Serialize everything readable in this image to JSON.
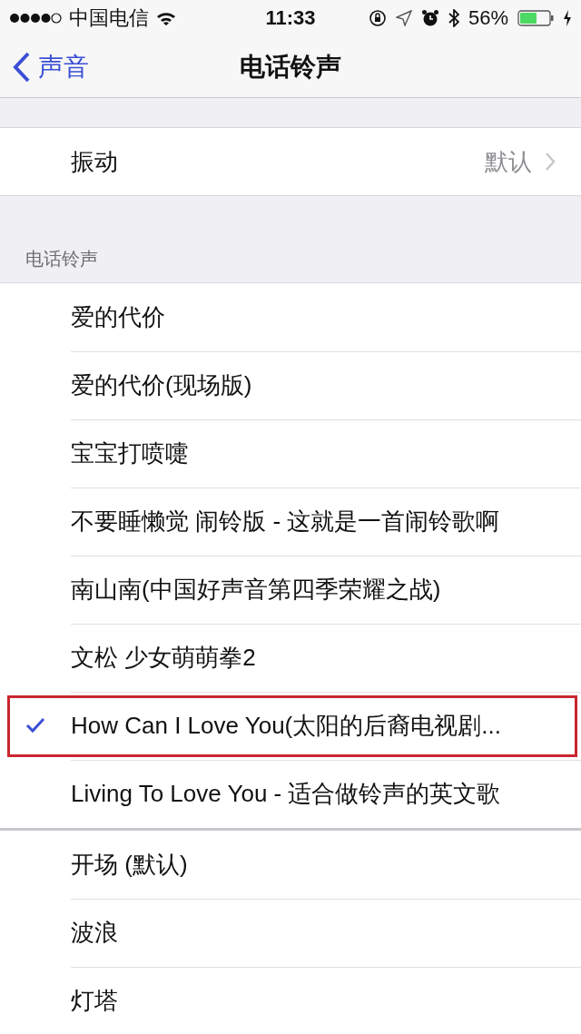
{
  "status_bar": {
    "carrier": "中国电信",
    "time": "11:33",
    "battery_percent": "56%"
  },
  "nav": {
    "back_label": "声音",
    "title": "电话铃声"
  },
  "vibration": {
    "label": "振动",
    "value": "默认"
  },
  "section_header": "电话铃声",
  "ringtone_groups": [
    {
      "items": [
        {
          "label": "爱的代价",
          "selected": false,
          "highlighted": false
        },
        {
          "label": "爱的代价(现场版)",
          "selected": false,
          "highlighted": false
        },
        {
          "label": "宝宝打喷嚏",
          "selected": false,
          "highlighted": false
        },
        {
          "label": "不要睡懒觉 闹铃版 - 这就是一首闹铃歌啊",
          "selected": false,
          "highlighted": false
        },
        {
          "label": "南山南(中国好声音第四季荣耀之战)",
          "selected": false,
          "highlighted": false
        },
        {
          "label": "文松 少女萌萌拳2",
          "selected": false,
          "highlighted": false
        },
        {
          "label": "How Can I Love You(太阳的后裔电视剧...",
          "selected": true,
          "highlighted": true
        },
        {
          "label": "Living To Love You - 适合做铃声的英文歌",
          "selected": false,
          "highlighted": false
        }
      ]
    },
    {
      "items": [
        {
          "label": "开场 (默认)",
          "selected": false,
          "highlighted": false
        },
        {
          "label": "波浪",
          "selected": false,
          "highlighted": false
        },
        {
          "label": "灯塔",
          "selected": false,
          "highlighted": false
        }
      ]
    }
  ]
}
